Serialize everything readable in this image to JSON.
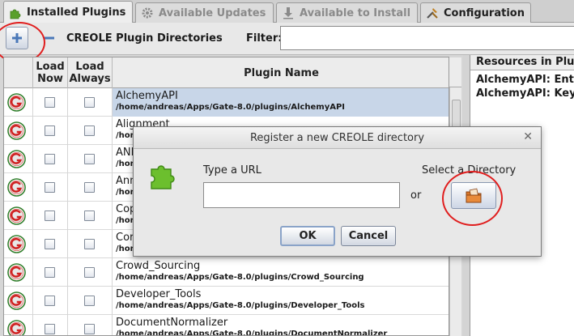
{
  "tabs": [
    {
      "label": "Installed Plugins",
      "icon": "puzzle-icon",
      "active": true
    },
    {
      "label": "Available Updates",
      "icon": "gear-icon",
      "active": false
    },
    {
      "label": "Available to Install",
      "icon": "download-icon",
      "active": false
    },
    {
      "label": "Configuration",
      "icon": "tools-icon",
      "active": false
    }
  ],
  "toolbar": {
    "add_icon": "plus-icon",
    "remove_icon": "minus-icon",
    "title": "CREOLE Plugin Directories",
    "filter_label": "Filter:",
    "filter_value": ""
  },
  "table": {
    "headers": {
      "icon": "",
      "load_now": "Load Now",
      "load_always": "Load Always",
      "plugin_name": "Plugin Name"
    },
    "rows": [
      {
        "name": "AlchemyAPI",
        "path": "/home/andreas/Apps/Gate-8.0/plugins/AlchemyAPI",
        "selected": true
      },
      {
        "name": "Alignment",
        "path": "/home/andreas/Apps/Gate-8.0/plugins/Alignment",
        "selected": false
      },
      {
        "name": "ANNIE",
        "path": "/home/andreas/Apps/Gate-8.0/plugins/ANNIE",
        "selected": false
      },
      {
        "name": "Annotation_Merging",
        "path": "/home/andreas/Apps/Gate-8.0/plugins/Annotation_Merging",
        "selected": false
      },
      {
        "name": "Copy_Annots_Between_Docs",
        "path": "/home/andreas/Apps/Gate-8.0/plugins/Copy_Annots_Between_Docs",
        "selected": false
      },
      {
        "name": "Coref_Tools",
        "path": "/home/andreas/Apps/Gate-8.0/plugins/Coref_Tools",
        "selected": false
      },
      {
        "name": "Crowd_Sourcing",
        "path": "/home/andreas/Apps/Gate-8.0/plugins/Crowd_Sourcing",
        "selected": false
      },
      {
        "name": "Developer_Tools",
        "path": "/home/andreas/Apps/Gate-8.0/plugins/Developer_Tools",
        "selected": false
      },
      {
        "name": "DocumentNormalizer",
        "path": "/home/andreas/Apps/Gate-8.0/plugins/DocumentNormalizer",
        "selected": false
      }
    ]
  },
  "resources": {
    "header": "Resources in Plugin",
    "items": [
      "AlchemyAPI: Entity",
      "AlchemyAPI: Keyword"
    ]
  },
  "dialog": {
    "title": "Register a new CREOLE directory",
    "close_icon": "close-icon",
    "url_label": "Type a URL",
    "url_value": "",
    "or_label": "or",
    "dir_label": "Select a Directory",
    "folder_icon": "folder-icon",
    "ok_label": "OK",
    "cancel_label": "Cancel"
  },
  "colors": {
    "highlight_circle": "#e01e1e",
    "selected_row": "#c8d6e8"
  }
}
